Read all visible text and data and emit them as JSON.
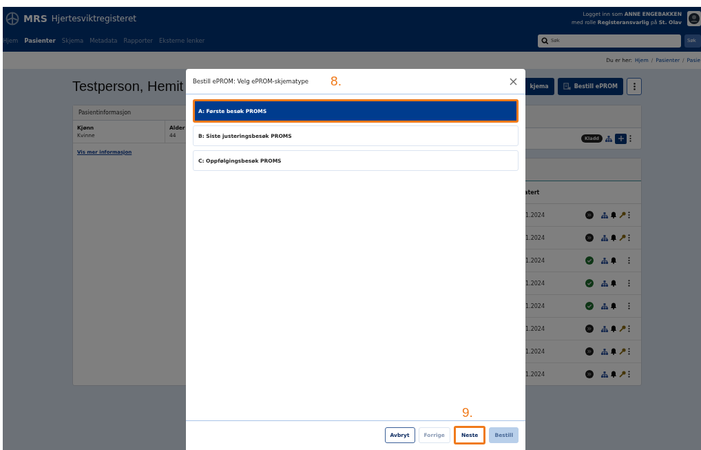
{
  "app": {
    "logo": "MRS",
    "name": "Hjertesviktregisteret"
  },
  "user": {
    "line1": "Logget inn som **ANNE ENGEBAKKEN**",
    "line2": "med rolle **Registeransvarlig** på **St. Olav**"
  },
  "nav": [
    {
      "label": "Hjem",
      "selected": false
    },
    {
      "label": "Pasienter",
      "selected": true
    },
    {
      "label": "Skjema",
      "selected": false
    },
    {
      "label": "Metadata",
      "selected": false
    },
    {
      "label": "Rapporter",
      "selected": false
    },
    {
      "label": "Eksterne lenker",
      "selected": false
    }
  ],
  "search": {
    "placeholder": "Søk",
    "button": "Søk"
  },
  "breadcrumb": {
    "prefix": "Du er her:",
    "separator": "/",
    "items": [
      "Hjem",
      "Pasienter",
      "Pasie"
    ]
  },
  "patient": {
    "name": "Testperson, Hemit"
  },
  "actions": [
    {
      "kind": "button",
      "label": "kjema"
    },
    {
      "kind": "order",
      "label": "Bestill ePROM"
    },
    {
      "kind": "menu"
    }
  ],
  "info_card": {
    "title": "Pasientinformasjon",
    "fields": [
      {
        "label": "Kjønn",
        "value": "Kvinne"
      },
      {
        "label": "Alder",
        "value": "44"
      }
    ],
    "link": "Vis mer informasjon"
  },
  "draft_card": {
    "status": "Kladd"
  },
  "forms_card": {
    "column_header": "atert",
    "rows": [
      {
        "date": "1.2024",
        "completed": false,
        "key": true
      },
      {
        "date": "1.2024",
        "completed": false,
        "key": true
      },
      {
        "date": "1.2024",
        "completed": true,
        "key": false
      },
      {
        "date": "1.2024",
        "completed": true,
        "key": false
      },
      {
        "date": "1.2024",
        "completed": true,
        "key": false
      },
      {
        "date": "1.2024",
        "completed": false,
        "key": true
      },
      {
        "date": "1.2024",
        "completed": false,
        "key": true
      },
      {
        "date": "1.2024",
        "completed": false,
        "key": true
      }
    ]
  },
  "modal": {
    "title": "Bestill ePROM: Velg ePROM-skjematype",
    "step": "8.",
    "footer_step": "9.",
    "options": [
      {
        "label": "A: Første besøk PROMS",
        "selected": true,
        "highlighted": true
      },
      {
        "label": "B: Siste justeringsbesøk PROMS",
        "selected": false,
        "highlighted": false
      },
      {
        "label": "C: Oppfølgingsbesøk PROMS",
        "selected": false,
        "highlighted": false
      }
    ],
    "buttons": [
      {
        "label": "Avbryt",
        "kind": "outline",
        "disabled": false,
        "highlighted": false
      },
      {
        "label": "Forrige",
        "kind": "outline",
        "disabled": true,
        "highlighted": false
      },
      {
        "label": "Neste",
        "kind": "outline",
        "disabled": false,
        "highlighted": true
      },
      {
        "label": "Bestill",
        "kind": "primary",
        "disabled": true,
        "highlighted": false
      }
    ]
  }
}
